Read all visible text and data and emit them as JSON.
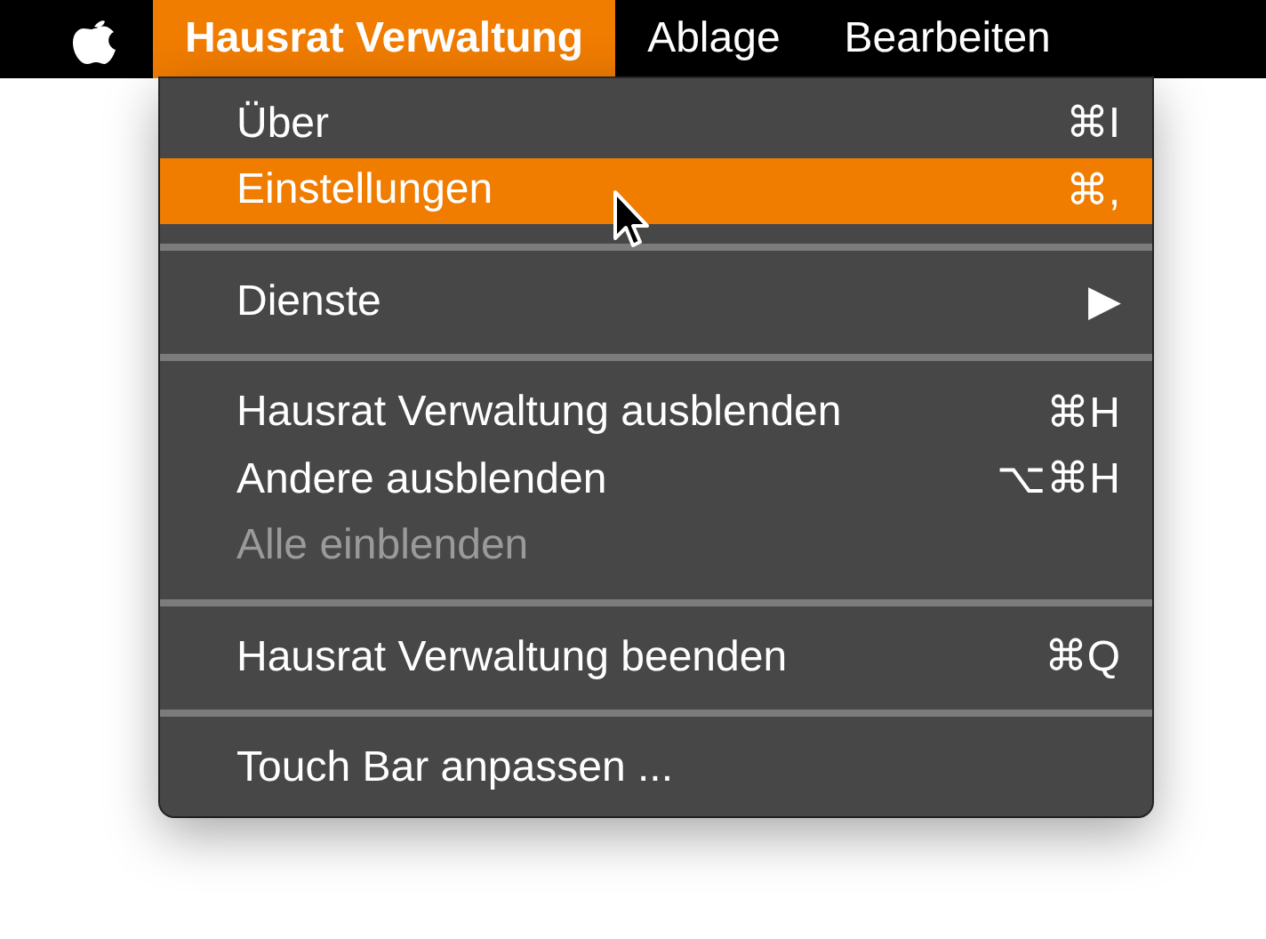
{
  "menu_bar": [
    {
      "kind": "apple",
      "selected": false
    },
    {
      "kind": "text",
      "label": "Hausrat Verwaltung",
      "selected": true
    },
    {
      "kind": "text",
      "label": "Ablage",
      "selected": false
    },
    {
      "kind": "text",
      "label": "Bearbeiten",
      "selected": false
    }
  ],
  "menu": {
    "items": [
      {
        "kind": "item",
        "label": "Über",
        "shortcut": "⌘I",
        "selected": false,
        "disabled": false
      },
      {
        "kind": "item",
        "label": "Einstellungen",
        "shortcut": "⌘,",
        "selected": true,
        "disabled": false
      },
      {
        "kind": "separator"
      },
      {
        "kind": "item",
        "label": "Dienste",
        "shortcut": "▶",
        "selected": false,
        "disabled": false
      },
      {
        "kind": "separator"
      },
      {
        "kind": "item",
        "label": "Hausrat Verwaltung ausblenden",
        "shortcut": "⌘H",
        "selected": false,
        "disabled": false
      },
      {
        "kind": "item",
        "label": "Andere ausblenden",
        "shortcut": "⌥⌘H",
        "selected": false,
        "disabled": false
      },
      {
        "kind": "item",
        "label": "Alle einblenden",
        "selected": false,
        "disabled": true
      },
      {
        "kind": "separator"
      },
      {
        "kind": "item",
        "label": "Hausrat Verwaltung beenden",
        "shortcut": "⌘Q",
        "selected": false,
        "disabled": false
      },
      {
        "kind": "separator"
      },
      {
        "kind": "item",
        "label": "Touch Bar anpassen ...",
        "selected": false,
        "disabled": false
      }
    ]
  }
}
